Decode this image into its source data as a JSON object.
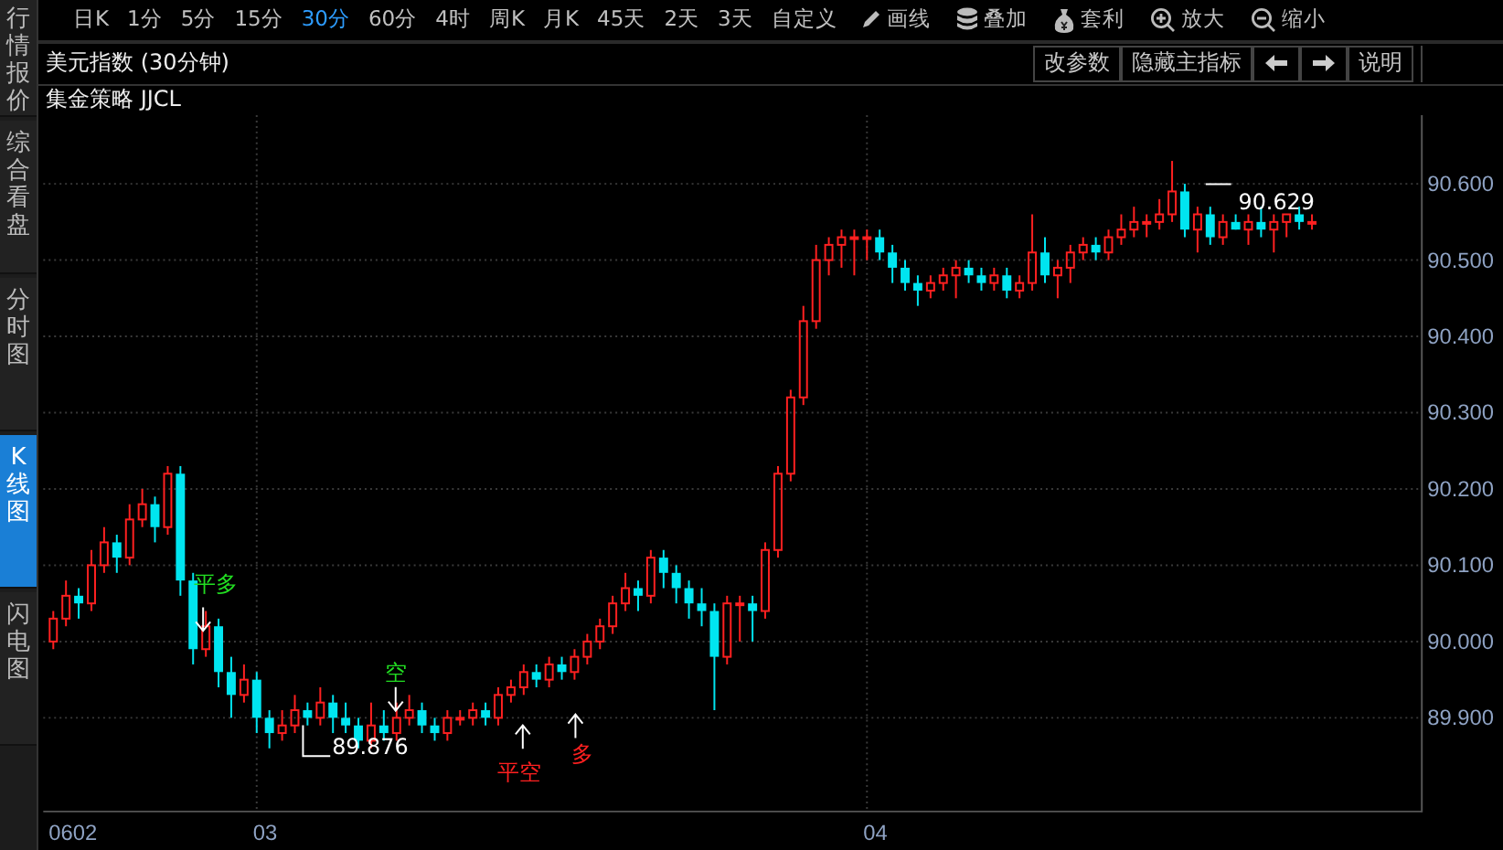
{
  "sidebar": {
    "items": [
      {
        "label": "行情报价",
        "selected": false
      },
      {
        "label": "综合看盘",
        "selected": false
      },
      {
        "label": "分时图",
        "selected": false
      },
      {
        "label": "K线图",
        "selected": true
      },
      {
        "label": "闪电图",
        "selected": false
      }
    ]
  },
  "periods": [
    {
      "label": "日K",
      "selected": false
    },
    {
      "label": "1分",
      "selected": false
    },
    {
      "label": "5分",
      "selected": false
    },
    {
      "label": "15分",
      "selected": false
    },
    {
      "label": "30分",
      "selected": true
    },
    {
      "label": "60分",
      "selected": false
    },
    {
      "label": "4时",
      "selected": false
    },
    {
      "label": "周K",
      "selected": false
    },
    {
      "label": "月K",
      "selected": false
    },
    {
      "label": "45天",
      "selected": false
    },
    {
      "label": "2天",
      "selected": false
    },
    {
      "label": "3天",
      "selected": false
    },
    {
      "label": "自定义",
      "selected": false
    }
  ],
  "tools": [
    {
      "label": "画线"
    },
    {
      "label": "叠加"
    },
    {
      "label": "套利"
    },
    {
      "label": "放大"
    },
    {
      "label": "缩小"
    }
  ],
  "chart_title": "美元指数 (30分钟)",
  "header_buttons": [
    "改参数",
    "隐藏主指标",
    "说明"
  ],
  "indicator": "集金策略 JJCL",
  "chart": {
    "chart_data": {
      "type": "candlestick",
      "ohlc": [
        [
          90.0,
          90.04,
          89.99,
          90.03
        ],
        [
          90.03,
          90.08,
          90.02,
          90.06
        ],
        [
          90.06,
          90.07,
          90.03,
          90.05
        ],
        [
          90.05,
          90.12,
          90.04,
          90.1
        ],
        [
          90.1,
          90.15,
          90.09,
          90.13
        ],
        [
          90.13,
          90.14,
          90.09,
          90.11
        ],
        [
          90.11,
          90.18,
          90.1,
          90.16
        ],
        [
          90.16,
          90.2,
          90.15,
          90.18
        ],
        [
          90.18,
          90.19,
          90.13,
          90.15
        ],
        [
          90.15,
          90.23,
          90.14,
          90.22
        ],
        [
          90.22,
          90.23,
          90.06,
          90.08
        ],
        [
          90.08,
          90.09,
          89.97,
          89.99
        ],
        [
          89.99,
          90.04,
          89.98,
          90.02
        ],
        [
          90.02,
          90.03,
          89.94,
          89.96
        ],
        [
          89.96,
          89.98,
          89.9,
          89.93
        ],
        [
          89.93,
          89.97,
          89.92,
          89.95
        ],
        [
          89.95,
          89.96,
          89.88,
          89.9
        ],
        [
          89.9,
          89.91,
          89.86,
          89.88
        ],
        [
          89.88,
          89.91,
          89.87,
          89.89
        ],
        [
          89.89,
          89.93,
          89.88,
          89.91
        ],
        [
          89.91,
          89.92,
          89.89,
          89.9
        ],
        [
          89.9,
          89.94,
          89.89,
          89.92
        ],
        [
          89.92,
          89.93,
          89.88,
          89.9
        ],
        [
          89.9,
          89.92,
          89.88,
          89.89
        ],
        [
          89.89,
          89.9,
          89.86,
          89.87
        ],
        [
          89.87,
          89.92,
          89.86,
          89.89
        ],
        [
          89.89,
          89.91,
          89.87,
          89.88
        ],
        [
          89.88,
          89.92,
          89.87,
          89.9
        ],
        [
          89.9,
          89.93,
          89.89,
          89.91
        ],
        [
          89.91,
          89.92,
          89.88,
          89.89
        ],
        [
          89.89,
          89.9,
          89.87,
          89.88
        ],
        [
          89.88,
          89.91,
          89.87,
          89.9
        ],
        [
          89.9,
          89.91,
          89.89,
          89.9
        ],
        [
          89.9,
          89.92,
          89.89,
          89.91
        ],
        [
          89.91,
          89.92,
          89.89,
          89.9
        ],
        [
          89.9,
          89.94,
          89.89,
          89.93
        ],
        [
          89.93,
          89.95,
          89.92,
          89.94
        ],
        [
          89.94,
          89.97,
          89.93,
          89.96
        ],
        [
          89.96,
          89.97,
          89.94,
          89.95
        ],
        [
          89.95,
          89.98,
          89.94,
          89.97
        ],
        [
          89.97,
          89.98,
          89.95,
          89.96
        ],
        [
          89.96,
          89.99,
          89.95,
          89.98
        ],
        [
          89.98,
          90.01,
          89.97,
          90.0
        ],
        [
          90.0,
          90.03,
          89.99,
          90.02
        ],
        [
          90.02,
          90.06,
          90.01,
          90.05
        ],
        [
          90.05,
          90.09,
          90.04,
          90.07
        ],
        [
          90.07,
          90.08,
          90.04,
          90.06
        ],
        [
          90.06,
          90.12,
          90.05,
          90.11
        ],
        [
          90.11,
          90.12,
          90.07,
          90.09
        ],
        [
          90.09,
          90.1,
          90.05,
          90.07
        ],
        [
          90.07,
          90.08,
          90.03,
          90.05
        ],
        [
          90.05,
          90.07,
          90.02,
          90.04
        ],
        [
          90.04,
          90.05,
          89.91,
          89.98
        ],
        [
          89.98,
          90.06,
          89.97,
          90.05
        ],
        [
          90.05,
          90.06,
          90.0,
          90.05
        ],
        [
          90.05,
          90.06,
          90.0,
          90.04
        ],
        [
          90.04,
          90.13,
          90.03,
          90.12
        ],
        [
          90.12,
          90.23,
          90.11,
          90.22
        ],
        [
          90.22,
          90.33,
          90.21,
          90.32
        ],
        [
          90.32,
          90.44,
          90.31,
          90.42
        ],
        [
          90.42,
          90.52,
          90.41,
          90.5
        ],
        [
          90.5,
          90.53,
          90.48,
          90.52
        ],
        [
          90.52,
          90.54,
          90.49,
          90.53
        ],
        [
          90.53,
          90.54,
          90.48,
          90.53
        ],
        [
          90.53,
          90.54,
          90.5,
          90.53
        ],
        [
          90.53,
          90.54,
          90.5,
          90.51
        ],
        [
          90.51,
          90.52,
          90.47,
          90.49
        ],
        [
          90.49,
          90.5,
          90.46,
          90.47
        ],
        [
          90.47,
          90.48,
          90.44,
          90.46
        ],
        [
          90.46,
          90.48,
          90.45,
          90.47
        ],
        [
          90.47,
          90.49,
          90.46,
          90.48
        ],
        [
          90.48,
          90.5,
          90.45,
          90.49
        ],
        [
          90.49,
          90.5,
          90.47,
          90.48
        ],
        [
          90.48,
          90.49,
          90.46,
          90.47
        ],
        [
          90.47,
          90.49,
          90.46,
          90.48
        ],
        [
          90.48,
          90.49,
          90.45,
          90.46
        ],
        [
          90.46,
          90.48,
          90.45,
          90.47
        ],
        [
          90.47,
          90.56,
          90.46,
          90.51
        ],
        [
          90.51,
          90.53,
          90.47,
          90.48
        ],
        [
          90.48,
          90.5,
          90.45,
          90.49
        ],
        [
          90.49,
          90.52,
          90.47,
          90.51
        ],
        [
          90.51,
          90.53,
          90.5,
          90.52
        ],
        [
          90.52,
          90.53,
          90.5,
          90.51
        ],
        [
          90.51,
          90.54,
          90.5,
          90.53
        ],
        [
          90.53,
          90.56,
          90.52,
          90.54
        ],
        [
          90.54,
          90.57,
          90.53,
          90.55
        ],
        [
          90.55,
          90.56,
          90.53,
          90.55
        ],
        [
          90.55,
          90.58,
          90.54,
          90.56
        ],
        [
          90.56,
          90.63,
          90.55,
          90.59
        ],
        [
          90.59,
          90.6,
          90.53,
          90.54
        ],
        [
          90.54,
          90.57,
          90.51,
          90.56
        ],
        [
          90.56,
          90.57,
          90.52,
          90.53
        ],
        [
          90.53,
          90.56,
          90.52,
          90.55
        ],
        [
          90.55,
          90.56,
          90.54,
          90.54
        ],
        [
          90.54,
          90.56,
          90.52,
          90.55
        ],
        [
          90.55,
          90.57,
          90.53,
          90.54
        ],
        [
          90.54,
          90.56,
          90.51,
          90.55
        ],
        [
          90.55,
          90.56,
          90.53,
          90.56
        ],
        [
          90.56,
          90.57,
          90.54,
          90.55
        ],
        [
          90.55,
          90.56,
          90.54,
          90.55
        ]
      ],
      "x": [
        2.6667,
        2.6875,
        2.7083,
        2.7292,
        2.75,
        2.7708,
        2.7917,
        2.8125,
        2.8333,
        2.8542,
        2.875,
        2.8958,
        2.9167,
        2.9375,
        2.9583,
        2.9792,
        3,
        3.0208,
        3.0417,
        3.0625,
        3.0833,
        3.1042,
        3.125,
        3.1458,
        3.1667,
        3.1875,
        3.2083,
        3.2292,
        3.25,
        3.2708,
        3.2917,
        3.3125,
        3.3333,
        3.3542,
        3.375,
        3.3958,
        3.4167,
        3.4375,
        3.4583,
        3.4792,
        3.5,
        3.5208,
        3.5417,
        3.5625,
        3.5833,
        3.6042,
        3.625,
        3.6458,
        3.6667,
        3.6875,
        3.7083,
        3.7292,
        3.75,
        3.7708,
        3.7917,
        3.8125,
        3.8333,
        3.8542,
        3.875,
        3.8958,
        3.9167,
        3.9375,
        3.9583,
        3.9792,
        4,
        4.0208,
        4.0417,
        4.0625,
        4.0833,
        4.1042,
        4.125,
        4.1458,
        4.1667,
        4.1875,
        4.2083,
        4.2292,
        4.25,
        4.2708,
        4.2917,
        4.3125,
        4.3333,
        4.3542,
        4.375,
        4.3958,
        4.4167,
        4.4375,
        4.4583,
        4.4792,
        4.5,
        4.5208,
        4.5417,
        4.5625,
        4.5833,
        4.6042,
        4.625,
        4.6458,
        4.6667,
        4.6875,
        4.7083,
        4.7292
      ],
      "xlim": [
        2.6503,
        4.9092
      ],
      "ylim": [
        89.776,
        90.69
      ],
      "grid": true,
      "xticks": [
        {
          "value": 3,
          "label": "03"
        },
        {
          "value": 4,
          "label": "04"
        }
      ],
      "yticks": [
        {
          "value": 90.6,
          "label": "90.600"
        },
        {
          "value": 90.5,
          "label": "90.500"
        },
        {
          "value": 90.4,
          "label": "90.400"
        },
        {
          "value": 90.3,
          "label": "90.300"
        },
        {
          "value": 90.2,
          "label": "90.200"
        },
        {
          "value": 90.1,
          "label": "90.100"
        },
        {
          "value": 90.0,
          "label": "90.000"
        },
        {
          "value": 89.9,
          "label": "89.900"
        }
      ]
    },
    "start_label": "0602",
    "price_labels": [
      "89.876",
      "90.629"
    ],
    "signals": [
      {
        "label": "平多",
        "kind": "sell"
      },
      {
        "label": "空",
        "kind": "sell"
      },
      {
        "label": "平空",
        "kind": "buy"
      },
      {
        "label": "多",
        "kind": "buy"
      }
    ]
  }
}
